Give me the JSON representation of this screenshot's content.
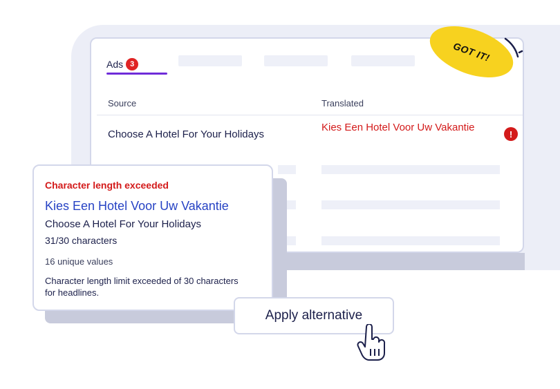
{
  "tabs": {
    "ads_label": "Ads",
    "ads_count": "3"
  },
  "table": {
    "columns": [
      "Source",
      "Translated"
    ],
    "rows": [
      {
        "source": "Choose A Hotel For Your Holidays",
        "translated": "Kies Een Hotel Voor Uw Vakantie",
        "status_icon": "exclamation-icon"
      }
    ]
  },
  "sticker": {
    "label": "GOT IT!"
  },
  "popup": {
    "error_title": "Character length exceeded",
    "translated": "Kies Een Hotel Voor Uw Vakantie",
    "source": "Choose A Hotel For Your Holidays",
    "char_count": "31/30 characters",
    "unique_values": "16 unique values",
    "description": "Character length limit exceeded of 30 characters for headlines."
  },
  "apply_button": {
    "label": "Apply alternative"
  },
  "colors": {
    "accent": "#6f2bd9",
    "error": "#d31a1a",
    "link_blue": "#2743c4",
    "sticker_yellow": "#f7d21f",
    "text": "#1b1f4a"
  }
}
